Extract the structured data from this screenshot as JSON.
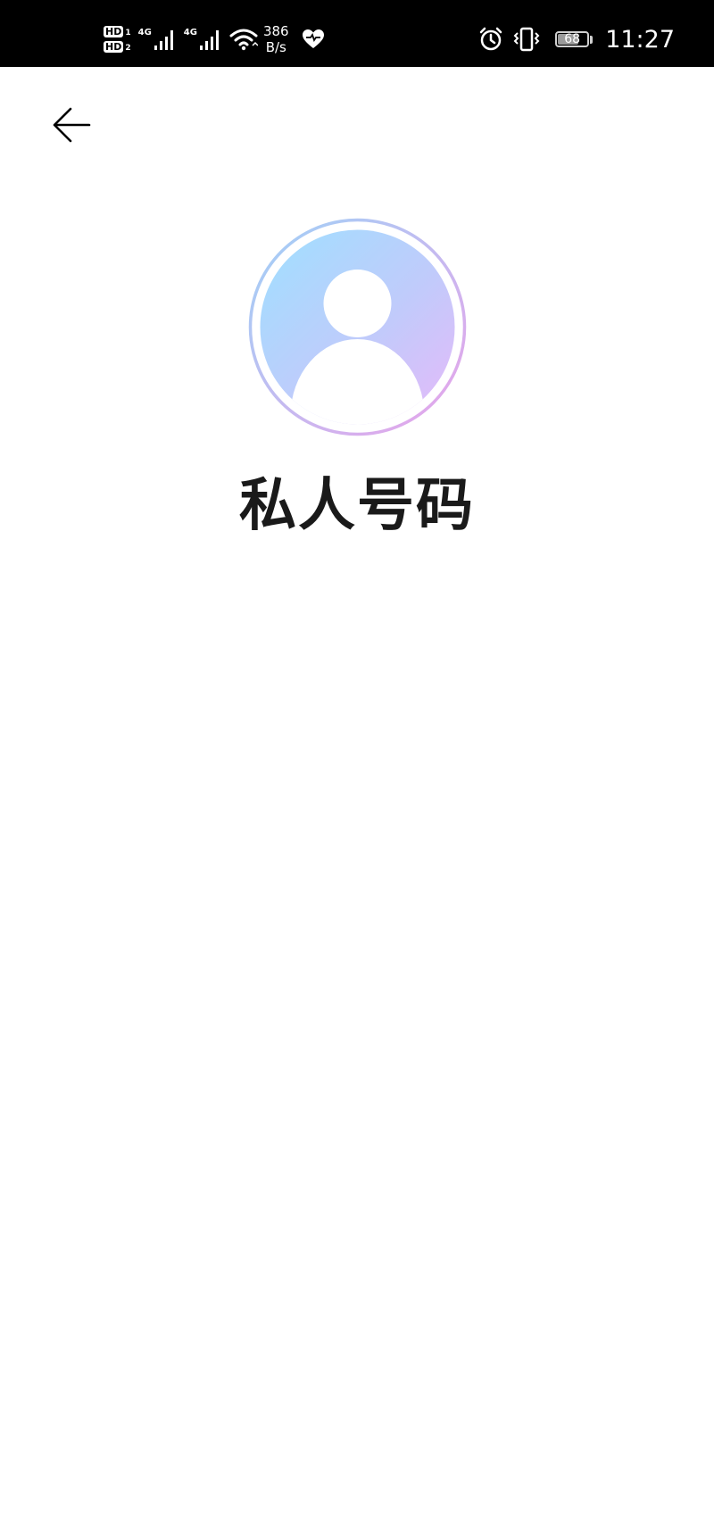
{
  "status_bar": {
    "sim1_label": "HD",
    "sim1_index": "1",
    "sim2_label": "HD",
    "sim2_index": "2",
    "network1": "4G",
    "network2": "4G",
    "speed_value": "386",
    "speed_unit": "B/s",
    "battery_level": "68",
    "time": "11:27",
    "icons": [
      "signal-icon",
      "wifi-icon",
      "health-heart-icon",
      "alarm-icon",
      "vibrate-icon",
      "battery-icon"
    ]
  },
  "header": {
    "back_icon": "arrow-left-icon"
  },
  "contact": {
    "avatar_icon": "person-silhouette-icon",
    "name": "私人号码"
  },
  "colors": {
    "avatar_gradient_start": "#a3dcff",
    "avatar_gradient_end": "#e2baf9",
    "ring_start": "#9fd2f7",
    "ring_end": "#e9a3ea",
    "title_text": "#1a1a1a",
    "status_bar_bg": "#000000"
  }
}
